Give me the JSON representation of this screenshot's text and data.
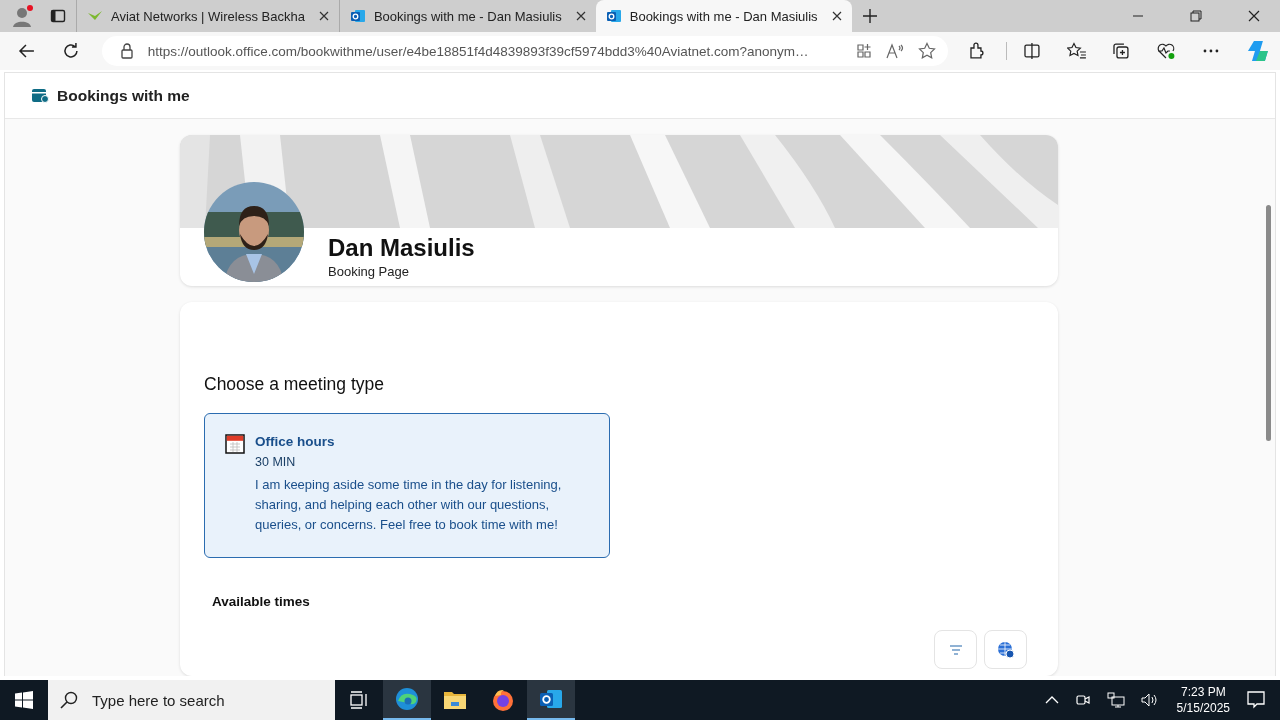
{
  "browser": {
    "tabs": [
      {
        "title": "Aviat Networks | Wireless Backha",
        "kind": "aviat",
        "selected": false
      },
      {
        "title": "Bookings with me - Dan Masiulis",
        "kind": "outlook",
        "selected": false
      },
      {
        "title": "Bookings with me - Dan Masiulis",
        "kind": "outlook",
        "selected": true
      }
    ],
    "url": "https://outlook.office.com/bookwithme/user/e4be18851f4d4839893f39cf5974bdd3%40Aviatnet.com?anonym…"
  },
  "app": {
    "title": "Bookings with me"
  },
  "profile": {
    "name": "Dan Masiulis",
    "subtitle": "Booking Page"
  },
  "meeting_section": {
    "heading": "Choose a meeting type",
    "types": [
      {
        "name": "Office hours",
        "duration": "30 MIN",
        "description": "I am keeping aside some time in the day for listening, sharing, and helping each other with our questions, queries, or concerns. Feel free to book time with me!",
        "selected": true
      }
    ],
    "available_heading": "Available times"
  },
  "taskbar": {
    "search_placeholder": "Type here to search",
    "apps": [
      {
        "kind": "taskview",
        "active": false
      },
      {
        "kind": "edge",
        "active": true
      },
      {
        "kind": "explorer",
        "active": false
      },
      {
        "kind": "firefox",
        "active": false
      },
      {
        "kind": "outlook",
        "active": true
      }
    ],
    "time": "7:23 PM",
    "date": "5/15/2025"
  }
}
